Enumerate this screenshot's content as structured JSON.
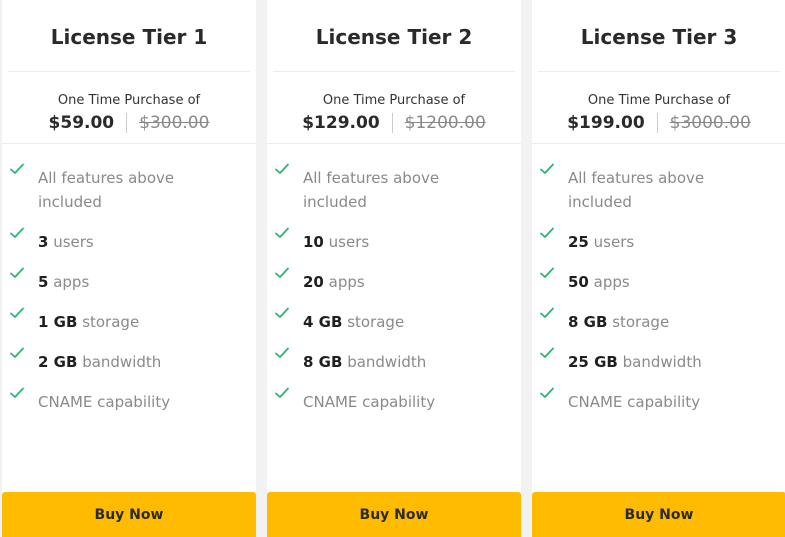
{
  "tiers": [
    {
      "title": "License Tier 1",
      "caption": "One Time Purchase of",
      "price": "$59.00",
      "old_price": "$300.00",
      "features": [
        {
          "value": "",
          "text": "All features above included"
        },
        {
          "value": "3",
          "text": "users"
        },
        {
          "value": "5",
          "text": "apps"
        },
        {
          "value": "1 GB",
          "text": "storage"
        },
        {
          "value": "2 GB",
          "text": "bandwidth"
        },
        {
          "value": "",
          "text": "CNAME capability"
        }
      ],
      "button": "Buy Now"
    },
    {
      "title": "License Tier 2",
      "caption": "One Time Purchase of",
      "price": "$129.00",
      "old_price": "$1200.00",
      "features": [
        {
          "value": "",
          "text": "All features above included"
        },
        {
          "value": "10",
          "text": "users"
        },
        {
          "value": "20",
          "text": "apps"
        },
        {
          "value": "4 GB",
          "text": "storage"
        },
        {
          "value": "8 GB",
          "text": "bandwidth"
        },
        {
          "value": "",
          "text": "CNAME capability"
        }
      ],
      "button": "Buy Now"
    },
    {
      "title": "License Tier 3",
      "caption": "One Time Purchase of",
      "price": "$199.00",
      "old_price": "$3000.00",
      "features": [
        {
          "value": "",
          "text": "All features above included"
        },
        {
          "value": "25",
          "text": "users"
        },
        {
          "value": "50",
          "text": "apps"
        },
        {
          "value": "8 GB",
          "text": "storage"
        },
        {
          "value": "25 GB",
          "text": "bandwidth"
        },
        {
          "value": "",
          "text": "CNAME capability"
        }
      ],
      "button": "Buy Now"
    }
  ],
  "icons": {
    "feature": "check-icon"
  },
  "colors": {
    "accent": "#ffbb00",
    "check": "#2bb673"
  }
}
